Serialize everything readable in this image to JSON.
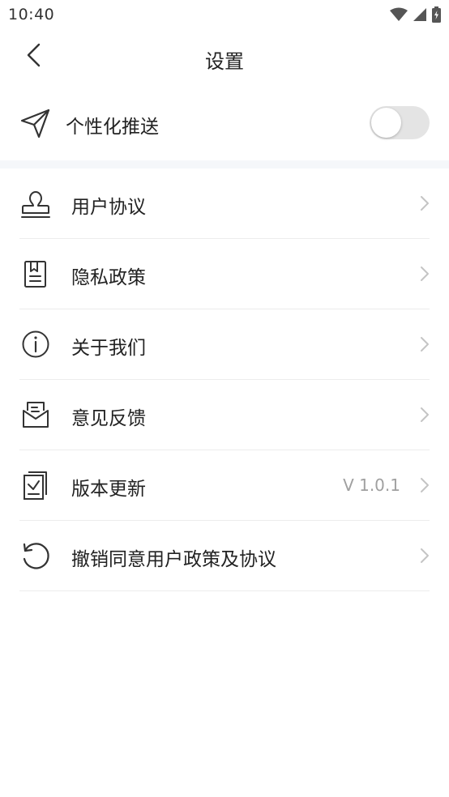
{
  "status_bar": {
    "time": "10:40"
  },
  "header": {
    "title": "设置"
  },
  "push": {
    "label": "个性化推送",
    "enabled": false
  },
  "menu": {
    "items": [
      {
        "label": "用户协议",
        "icon": "user-stamp-icon",
        "value": ""
      },
      {
        "label": "隐私政策",
        "icon": "document-icon",
        "value": ""
      },
      {
        "label": "关于我们",
        "icon": "info-icon",
        "value": ""
      },
      {
        "label": "意见反馈",
        "icon": "feedback-mail-icon",
        "value": ""
      },
      {
        "label": "版本更新",
        "icon": "version-update-icon",
        "value": "V 1.0.1"
      },
      {
        "label": "撤销同意用户政策及协议",
        "icon": "revoke-icon",
        "value": ""
      }
    ]
  },
  "colors": {
    "text": "#222222",
    "muted": "#a0a0a0",
    "toggle_off": "#e4e4e4",
    "band": "#f5f7fa"
  }
}
